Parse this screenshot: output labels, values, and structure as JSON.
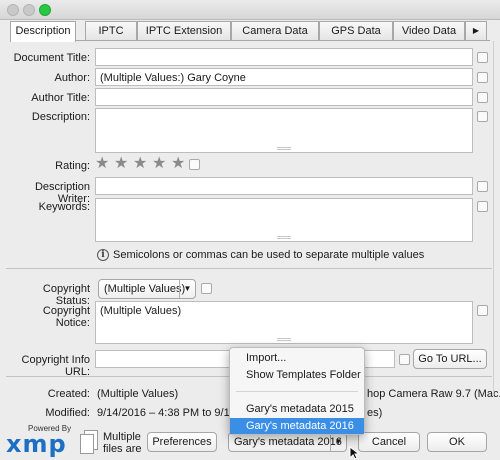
{
  "tabs": [
    "Description",
    "IPTC",
    "IPTC Extension",
    "Camera Data",
    "GPS Data",
    "Video Data"
  ],
  "tab_more": "▶",
  "labels": {
    "document_title": "Document Title:",
    "author": "Author:",
    "author_title": "Author Title:",
    "description": "Description:",
    "rating": "Rating:",
    "description_writer": "Description Writer:",
    "keywords": "Keywords:",
    "copyright_status": "Copyright Status:",
    "copyright_notice": "Copyright Notice:",
    "copyright_info_url": "Copyright Info URL:",
    "created": "Created:",
    "modified": "Modified:"
  },
  "values": {
    "document_title": "",
    "author": "(Multiple Values:) Gary Coyne",
    "author_title": "",
    "description": "",
    "description_writer": "",
    "keywords": "",
    "copyright_status": "(Multiple Values)",
    "copyright_notice": "(Multiple Values)",
    "copyright_info_url": "",
    "created": "(Multiple Values)",
    "modified": "9/14/2016 – 4:38 PM to 9/15/",
    "application_partial": "hop Camera Raw 9.7 (Mac...",
    "format_partial": "es)"
  },
  "rating_stars": 5,
  "keywords_hint": "Semicolons or commas can be used to separate multiple values",
  "buttons": {
    "go_to_url": "Go To URL...",
    "preferences": "Preferences",
    "cancel": "Cancel",
    "ok": "OK"
  },
  "template_select": "Gary's metadata 2016",
  "dropdown_menu": {
    "items": [
      "Import...",
      "Show Templates Folder"
    ],
    "templates": [
      "Gary's metadata 2015",
      "Gary's metadata 2016"
    ],
    "selected": "Gary's metadata 2016"
  },
  "branding": {
    "powered_by": "Powered By",
    "logo": "xmp"
  },
  "multiple_files_note": [
    "Multiple",
    "files are"
  ],
  "colors": {
    "selection": "#3a8ee6",
    "xmp_blue": "#1d6fc4"
  }
}
